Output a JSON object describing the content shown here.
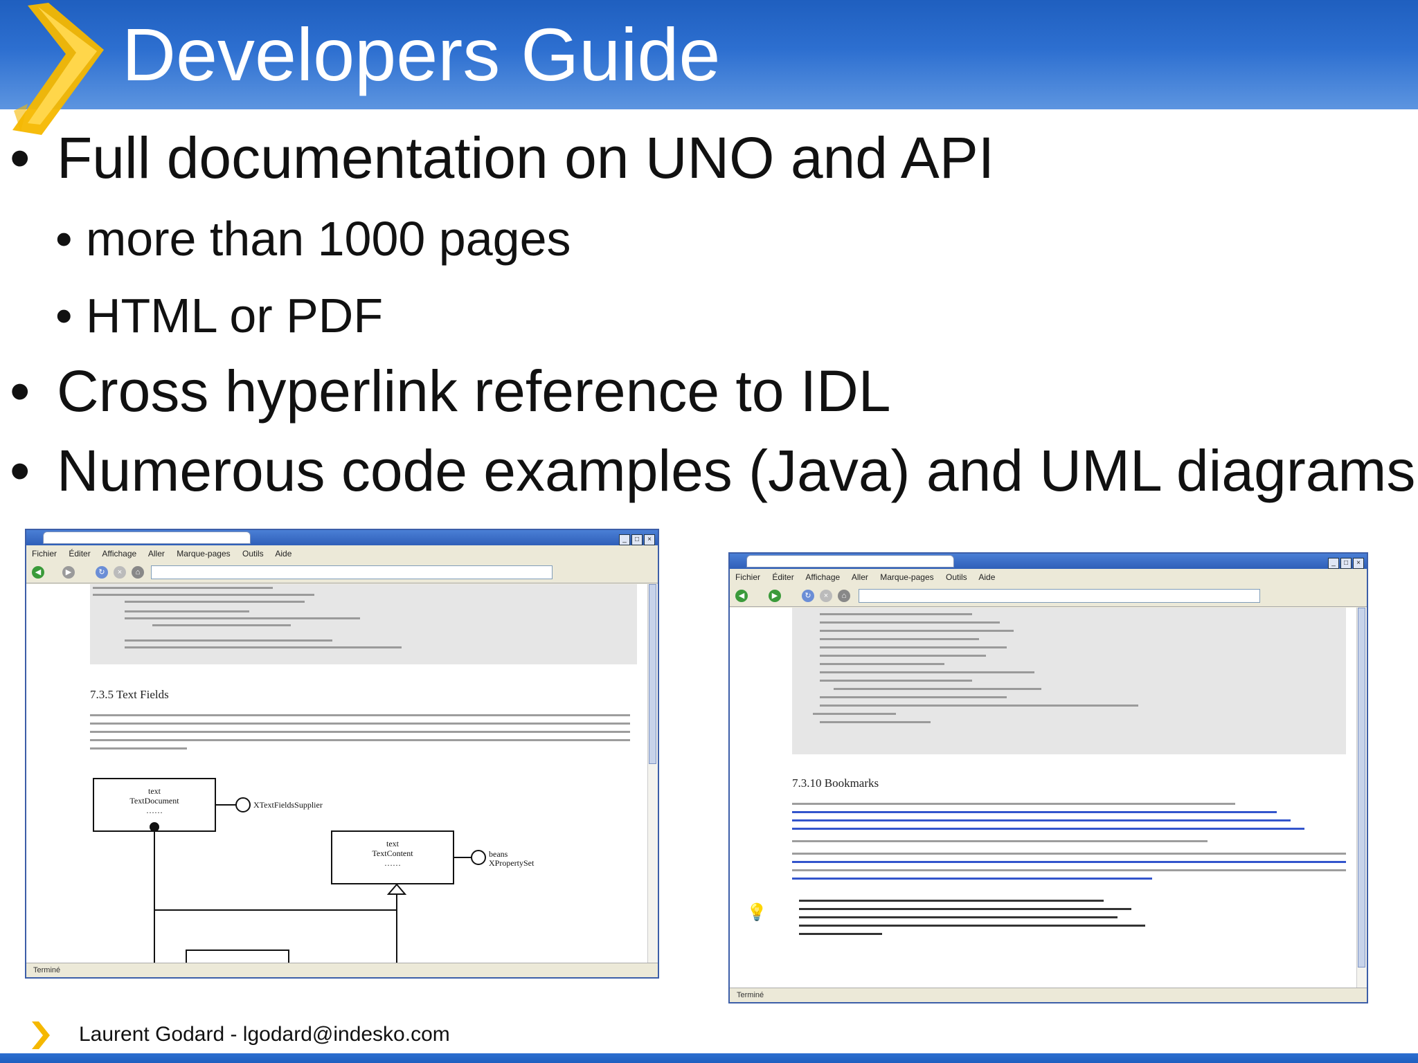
{
  "slide": {
    "title": "Developers Guide",
    "bullets": [
      {
        "text": "Full documentation on UNO and API",
        "sub": [
          "more than 1000 pages",
          "HTML or PDF"
        ]
      },
      {
        "text": "Cross hyperlink reference to IDL"
      },
      {
        "text": "Numerous code examples (Java) and UML diagrams"
      }
    ],
    "footer": "Laurent Godard - lgodard@indesko.com"
  },
  "colors": {
    "header": "#2d6fd0",
    "logo": "#f5b800",
    "link": "#3355cc"
  },
  "screenshot_left": {
    "menu": [
      "Fichier",
      "Éditer",
      "Affichage",
      "Aller",
      "Marque-pages",
      "Outils",
      "Aide"
    ],
    "status": "Terminé",
    "section_heading": "7.3.5   Text Fields",
    "uml": {
      "box1": [
        "text",
        "TextDocument",
        "……"
      ],
      "interface1": "XTextFieldsSupplier",
      "box2": [
        "text",
        "TextContent",
        "……"
      ],
      "interface2": [
        "beans",
        "XPropertySet"
      ]
    }
  },
  "screenshot_right": {
    "menu": [
      "Fichier",
      "Éditer",
      "Affichage",
      "Aller",
      "Marque-pages",
      "Outils",
      "Aide"
    ],
    "status": "Terminé",
    "section_heading": "7.3.10   Bookmarks"
  }
}
